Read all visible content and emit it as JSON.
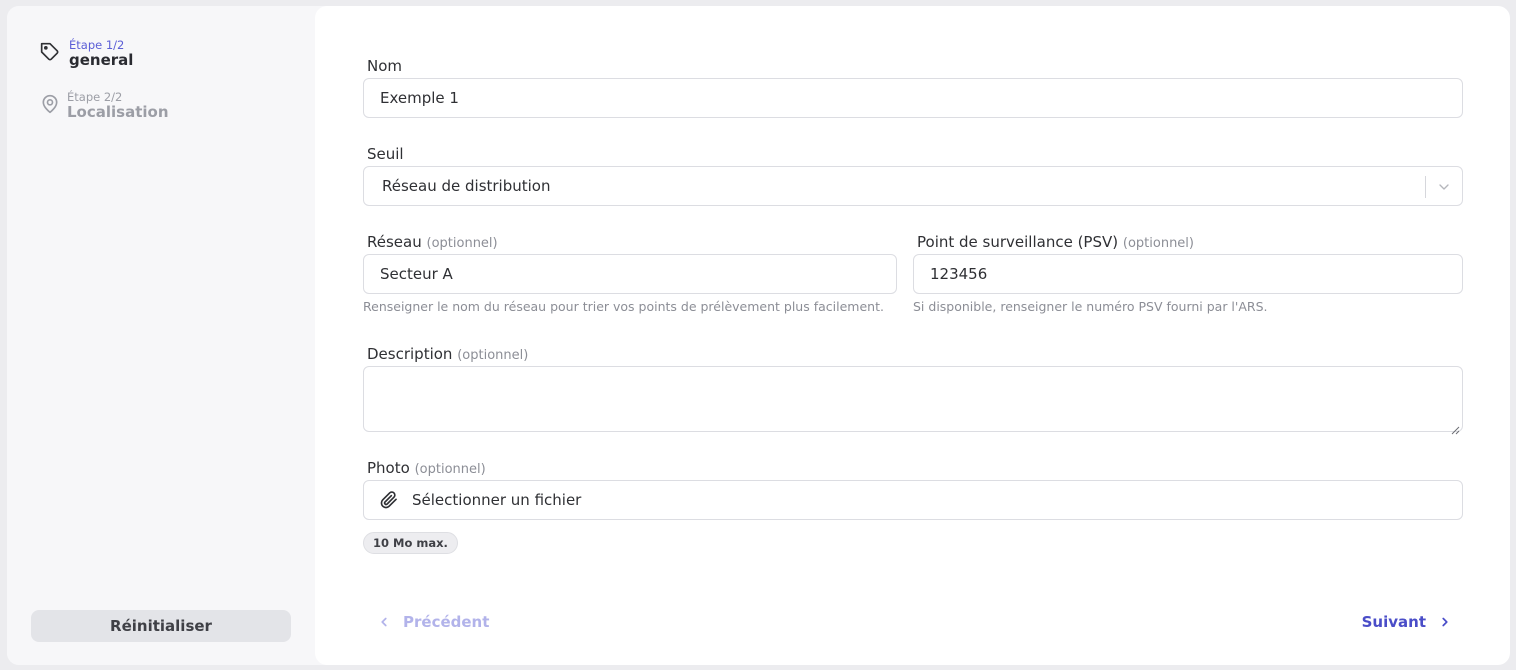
{
  "sidebar": {
    "steps": [
      {
        "sub": "Étape 1/2",
        "label": "general",
        "icon": "tag-icon",
        "active": true
      },
      {
        "sub": "Étape 2/2",
        "label": "Localisation",
        "icon": "map-pin-icon",
        "active": false
      }
    ],
    "reset_label": "Réinitialiser"
  },
  "form": {
    "nom": {
      "label": "Nom",
      "value": "Exemple 1"
    },
    "seuil": {
      "label": "Seuil",
      "value": "Réseau de distribution"
    },
    "reseau": {
      "label": "Réseau",
      "optional": "(optionnel)",
      "value": "Secteur A",
      "help": "Renseigner le nom du réseau pour trier vos points de prélèvement plus facilement."
    },
    "psv": {
      "label": "Point de surveillance (PSV)",
      "optional": "(optionnel)",
      "value": "123456",
      "help": "Si disponible, renseigner le numéro PSV fourni par l'ARS."
    },
    "description": {
      "label": "Description",
      "optional": "(optionnel)",
      "value": ""
    },
    "photo": {
      "label": "Photo",
      "optional": "(optionnel)",
      "button_label": "Sélectionner un fichier",
      "size_hint": "10 Mo max."
    }
  },
  "nav": {
    "prev_label": "Précédent",
    "next_label": "Suivant"
  },
  "colors": {
    "accent": "#4a4dc8",
    "accent_light": "#b2b3ea",
    "muted": "#8c8e96"
  }
}
